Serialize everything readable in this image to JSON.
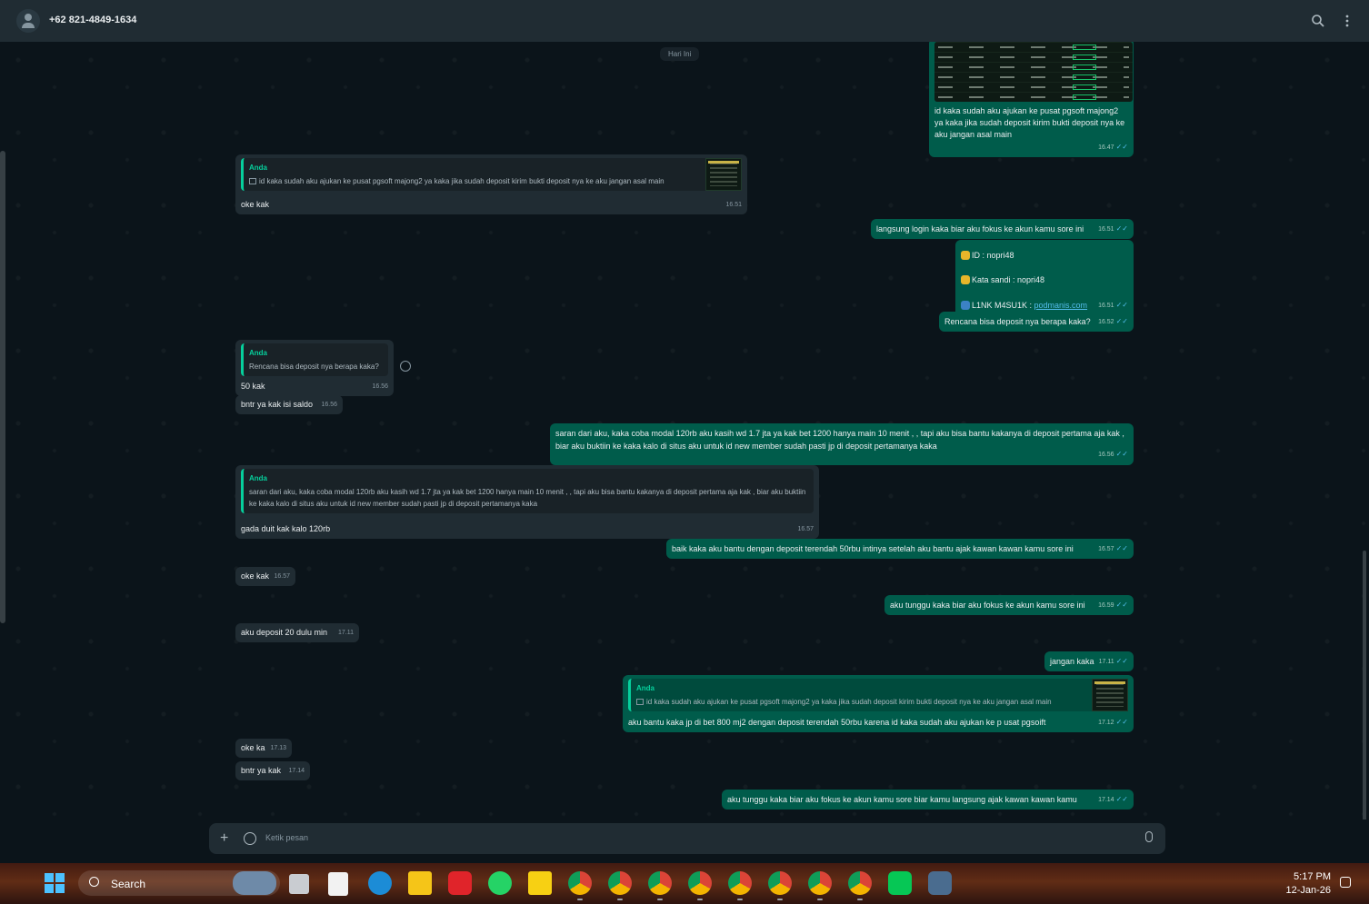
{
  "header": {
    "contact": "+62 821-4849-1634",
    "icons": [
      "search-icon",
      "more-vert-icon"
    ]
  },
  "chat": {
    "day_label": "Hari Ini",
    "messages": [
      {
        "dir": "out",
        "image": true,
        "text": "id kaka sudah aku ajukan ke pusat pgsoft majong2 ya kaka jika sudah deposit kirim bukti deposit nya ke aku jangan asal main",
        "time": "16.47"
      },
      {
        "dir": "in",
        "quote_author": "Anda",
        "quote_text": "id kaka sudah aku ajukan ke pusat pgsoft majong2 ya kaka jika sudah deposit kirim bukti deposit nya ke aku jangan asal main",
        "text": "oke kak",
        "time": "16.51"
      },
      {
        "dir": "out",
        "text": "langsung login kaka biar aku fokus ke akun kamu sore ini",
        "time": "16.51"
      },
      {
        "dir": "out",
        "line1": "ID :  nopri48",
        "line2": "Kata sandi : nopri48",
        "line3_prefix": "L1NK M4SU1K : ",
        "link": "podmanis.com",
        "time": "16.51"
      },
      {
        "dir": "out",
        "text": "Rencana bisa deposit nya berapa kaka?",
        "time": "16.52"
      },
      {
        "dir": "in",
        "quote_author": "Anda",
        "quote_text": "Rencana bisa deposit nya berapa kaka?",
        "text": "50 kak",
        "time": "16.56"
      },
      {
        "dir": "in",
        "text": "bntr ya kak isi saldo",
        "time": "16.56"
      },
      {
        "dir": "out",
        "text": "saran dari aku, kaka coba modal 120rb aku kasih wd 1.7 jta ya kak bet 1200 hanya main 10 menit , , tapi aku bisa bantu kakanya di deposit pertama aja kak , biar aku buktiin ke kaka kalo di situs aku untuk id new member sudah pasti jp di deposit pertamanya kaka",
        "time": "16.56"
      },
      {
        "dir": "in",
        "quote_author": "Anda",
        "quote_text": "saran dari aku, kaka coba modal 120rb aku kasih wd 1.7 jta ya kak bet 1200 hanya main 10 menit , , tapi aku bisa bantu kakanya di deposit pertama aja kak , biar aku buktiin ke kaka kalo di situs aku untuk id new member sudah pasti jp di deposit pertamanya kaka",
        "text": "gada duit kak kalo 120rb",
        "time": "16.57"
      },
      {
        "dir": "out",
        "text": "baik kaka aku bantu dengan deposit terendah 50rbu intinya setelah aku bantu ajak kawan kawan kamu sore ini",
        "time": "16.57"
      },
      {
        "dir": "in",
        "text": "oke kak",
        "time": "16.57"
      },
      {
        "dir": "out",
        "text": "aku tunggu kaka biar aku fokus ke akun kamu sore ini",
        "time": "16.59"
      },
      {
        "dir": "in",
        "text": "aku deposit 20 dulu min",
        "time": "17.11"
      },
      {
        "dir": "out",
        "text": "jangan kaka",
        "time": "17.11"
      },
      {
        "dir": "out",
        "quote_author": "Anda",
        "quote_text": "id kaka sudah aku ajukan ke pusat pgsoft majong2 ya kaka jika sudah deposit kirim bukti deposit nya ke aku jangan asal main",
        "text": "aku bantu kaka jp di bet 800 mj2 dengan deposit terendah 50rbu karena id kaka sudah aku ajukan ke p usat pgsoift",
        "time": "17.12"
      },
      {
        "dir": "in",
        "text": "oke ka",
        "time": "17.13"
      },
      {
        "dir": "in",
        "text": "bntr ya kak",
        "time": "17.14"
      },
      {
        "dir": "out",
        "text": "aku tunggu kaka biar aku fokus ke akun kamu sore biar kamu langsung ajak kawan kawan kamu",
        "time": "17.14"
      }
    ]
  },
  "composer": {
    "placeholder": "Ketik pesan"
  },
  "taskbar": {
    "search_label": "Search",
    "time": "5:17 PM",
    "date": "12-Jan-26",
    "apps": [
      "widgets-icon",
      "task-view-icon",
      "text-editor-icon",
      "edge-icon",
      "file-explorer-icon",
      "wps-icon",
      "whatsapp-icon",
      "sticky-notes-icon",
      "chrome-icon",
      "chrome-icon",
      "chrome-icon",
      "chrome-icon",
      "chrome-icon",
      "chrome-icon",
      "chrome-icon",
      "chrome-icon",
      "line-icon",
      "app-icon"
    ],
    "colors": {
      "accent": "#4cc2ff",
      "whatsapp": "#25d366",
      "line": "#06c755"
    }
  },
  "theme": {
    "outgoing": "#005c4b",
    "incoming": "#202c33",
    "background": "#0b141a",
    "quote_accent": "#06cf9c",
    "ticks": "#53bdeb"
  }
}
